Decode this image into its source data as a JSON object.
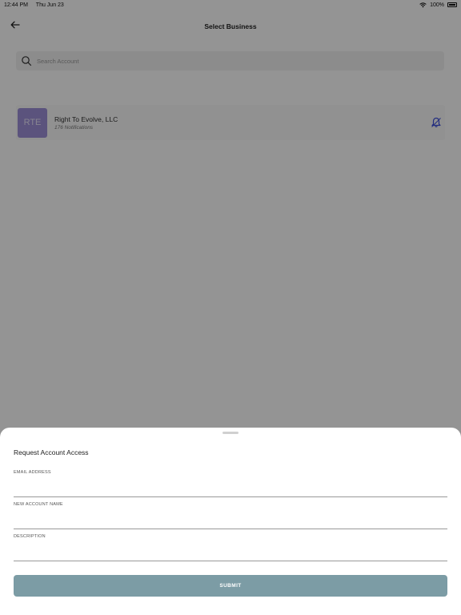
{
  "status_bar": {
    "time": "12:44 PM",
    "date": "Thu Jun 23",
    "battery": "100%",
    "wifi_icon": "wifi-icon",
    "battery_icon": "battery-icon"
  },
  "header": {
    "title": "Select Business",
    "back_icon": "arrow-left-icon"
  },
  "search": {
    "placeholder": "Search Account",
    "icon": "search-icon"
  },
  "businesses": [
    {
      "initials": "RTE",
      "name": "Right To Evolve, LLC",
      "subtitle": "176 Notifications",
      "avatar_color": "#9d8fd8",
      "icon": "bell-icon",
      "icon_color": "#3b4ddb"
    }
  ],
  "sheet": {
    "title": "Request Account Access",
    "fields": {
      "email_label": "EMAIL ADDRESS",
      "email_value": "",
      "account_name_label": "NEW ACCOUNT NAME",
      "account_name_value": "",
      "description_label": "DESCRIPTION",
      "description_value": ""
    },
    "submit_label": "SUBMIT"
  },
  "colors": {
    "overlay": "rgba(0,0,0,0.42)",
    "submit_button": "#7c9ca5",
    "avatar": "#9d8fd8",
    "bell": "#3b4ddb"
  }
}
